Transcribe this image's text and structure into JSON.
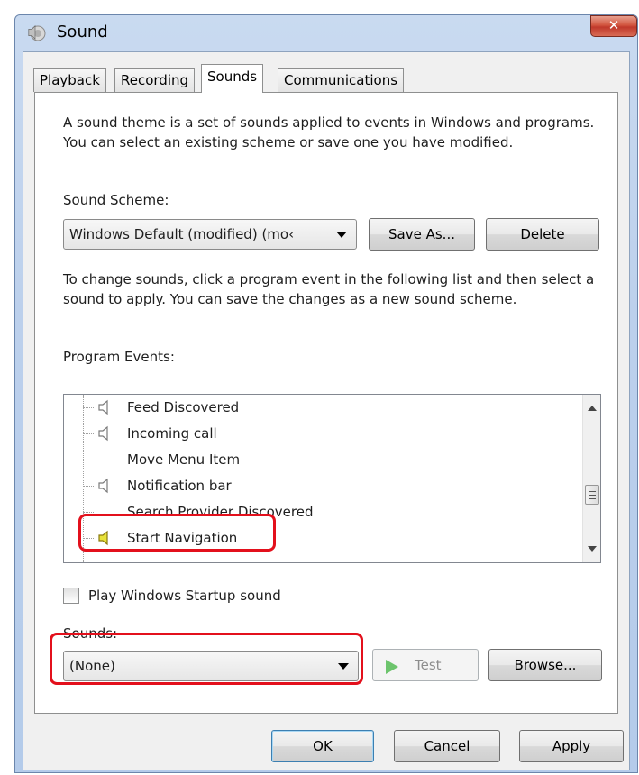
{
  "window": {
    "title": "Sound",
    "close_glyph": "✕"
  },
  "tabs": [
    {
      "label": "Playback",
      "active": false
    },
    {
      "label": "Recording",
      "active": false
    },
    {
      "label": "Sounds",
      "active": true
    },
    {
      "label": "Communications",
      "active": false
    }
  ],
  "sounds_tab": {
    "intro": "A sound theme is a set of sounds applied to events in Windows and programs.  You can select an existing scheme or save one you have modified.",
    "scheme_label": "Sound Scheme:",
    "scheme_value": "Windows Default (modified) (mo‹",
    "save_as_label": "Save As...",
    "delete_label": "Delete",
    "instructions": "To change sounds, click a program event in the following list and then select a sound to apply.  You can save the changes as a new sound scheme.",
    "events_label": "Program Events:",
    "events": [
      {
        "label": "Feed Discovered",
        "has_sound": true,
        "selected": false
      },
      {
        "label": "Incoming call",
        "has_sound": true,
        "selected": false
      },
      {
        "label": "Move Menu Item",
        "has_sound": false,
        "selected": false
      },
      {
        "label": "Notification bar",
        "has_sound": true,
        "selected": false
      },
      {
        "label": "Search Provider Discovered",
        "has_sound": false,
        "selected": false
      },
      {
        "label": "Start Navigation",
        "has_sound": true,
        "selected": true
      }
    ],
    "startup_checkbox_label": "Play Windows Startup sound",
    "startup_checked": false,
    "sounds_label": "Sounds:",
    "sounds_value": "(None)",
    "test_label": "Test",
    "browse_label": "Browse..."
  },
  "footer": {
    "ok_label": "OK",
    "cancel_label": "Cancel",
    "apply_label": "Apply"
  },
  "colors": {
    "highlight": "#e3101c",
    "title_bar": "#c9daf0",
    "close_button": "#c0392b",
    "speaker_active": "#e8e23a"
  },
  "icons": {
    "title": "speaker-icon",
    "event_sound": "speaker-icon",
    "test": "play-icon",
    "combo": "chevron-down-icon"
  }
}
